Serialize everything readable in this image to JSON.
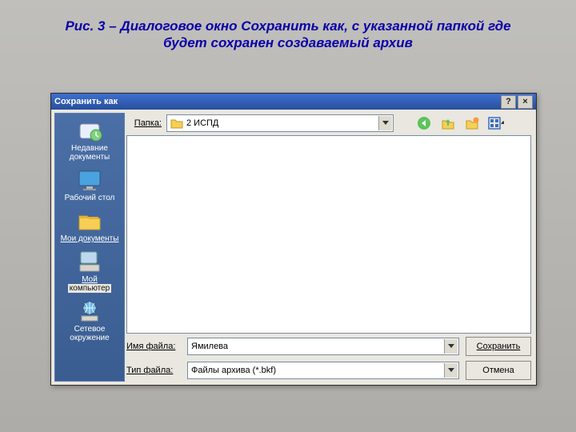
{
  "caption_line1": "Рис. 3 – Диалоговое окно Сохранить как, с указанной папкой где",
  "caption_line2": "будет сохранен создаваемый архив",
  "dialog": {
    "title": "Сохранить как",
    "help_btn": "?",
    "close_btn": "×",
    "folder_label": "Папка:",
    "folder_value": "2 ИСПД",
    "filename_label": "Имя файла:",
    "filename_value": "Ямилева",
    "filetype_label": "Тип файла:",
    "filetype_value": "Файлы архива (*.bkf)",
    "save_btn": "Сохранить",
    "cancel_btn": "Отмена"
  },
  "sidebar": {
    "recent": "Недавние документы",
    "desktop": "Рабочий стол",
    "mydocs": "Мои документы",
    "mycomp1": "Мой",
    "mycomp2": "компьютер",
    "network": "Сетевое окружение"
  }
}
